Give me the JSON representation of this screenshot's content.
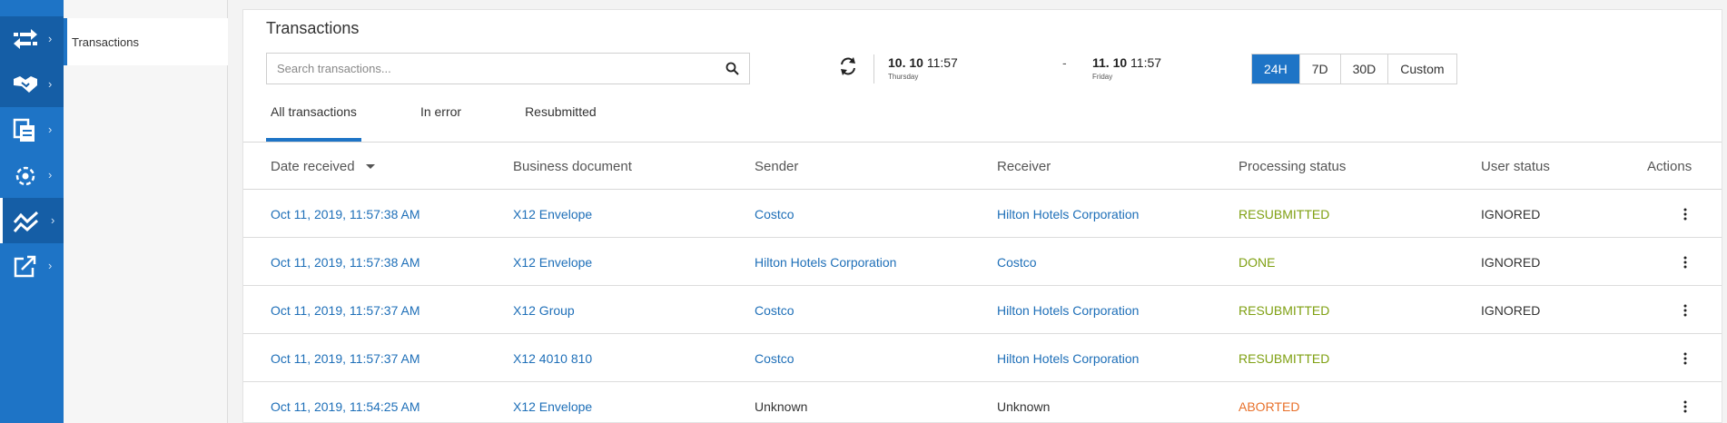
{
  "sidebar": {
    "flyout_label": "Transactions",
    "items": [
      {
        "icon": "transfer-arrows-icon"
      },
      {
        "icon": "handshake-icon"
      },
      {
        "icon": "documents-icon"
      },
      {
        "icon": "network-gear-icon"
      },
      {
        "icon": "analytics-icon"
      },
      {
        "icon": "external-link-icon"
      }
    ]
  },
  "main": {
    "title": "Transactions",
    "search": {
      "placeholder": "Search transactions...",
      "value": ""
    },
    "date_range": {
      "from_date": "10. 10",
      "from_time": "11:57",
      "from_day": "Thursday",
      "separator": "-",
      "to_date": "11. 10",
      "to_time": "11:57",
      "to_day": "Friday"
    },
    "range_buttons": [
      "24H",
      "7D",
      "30D",
      "Custom"
    ],
    "selected_range": "24H",
    "tabs": [
      {
        "label": "All transactions",
        "active": true
      },
      {
        "label": "In error",
        "active": false
      },
      {
        "label": "Resubmitted",
        "active": false
      }
    ],
    "table": {
      "headers": {
        "date": "Date received",
        "document": "Business document",
        "sender": "Sender",
        "receiver": "Receiver",
        "processing": "Processing status",
        "user": "User status",
        "actions": "Actions"
      },
      "rows": [
        {
          "date": "Oct 11, 2019, 11:57:38 AM",
          "document": "X12 Envelope",
          "sender": "Costco",
          "receiver": "Hilton Hotels Corporation",
          "processing": "RESUBMITTED",
          "user": "IGNORED"
        },
        {
          "date": "Oct 11, 2019, 11:57:38 AM",
          "document": "X12 Envelope",
          "sender": "Hilton Hotels Corporation",
          "receiver": "Costco",
          "processing": "DONE",
          "user": "IGNORED"
        },
        {
          "date": "Oct 11, 2019, 11:57:37 AM",
          "document": "X12 Group",
          "sender": "Costco",
          "receiver": "Hilton Hotels Corporation",
          "processing": "RESUBMITTED",
          "user": "IGNORED"
        },
        {
          "date": "Oct 11, 2019, 11:57:37 AM",
          "document": "X12 4010 810",
          "sender": "Costco",
          "receiver": "Hilton Hotels Corporation",
          "processing": "RESUBMITTED",
          "user": ""
        },
        {
          "date": "Oct 11, 2019, 11:54:25 AM",
          "document": "X12 Envelope",
          "sender": "Unknown",
          "receiver": "Unknown",
          "processing": "ABORTED",
          "user": ""
        }
      ]
    }
  },
  "colors": {
    "brand": "#1e74c6",
    "link": "#1e6fb8",
    "status_ok": "#7fa012",
    "status_aborted": "#e8702a"
  }
}
